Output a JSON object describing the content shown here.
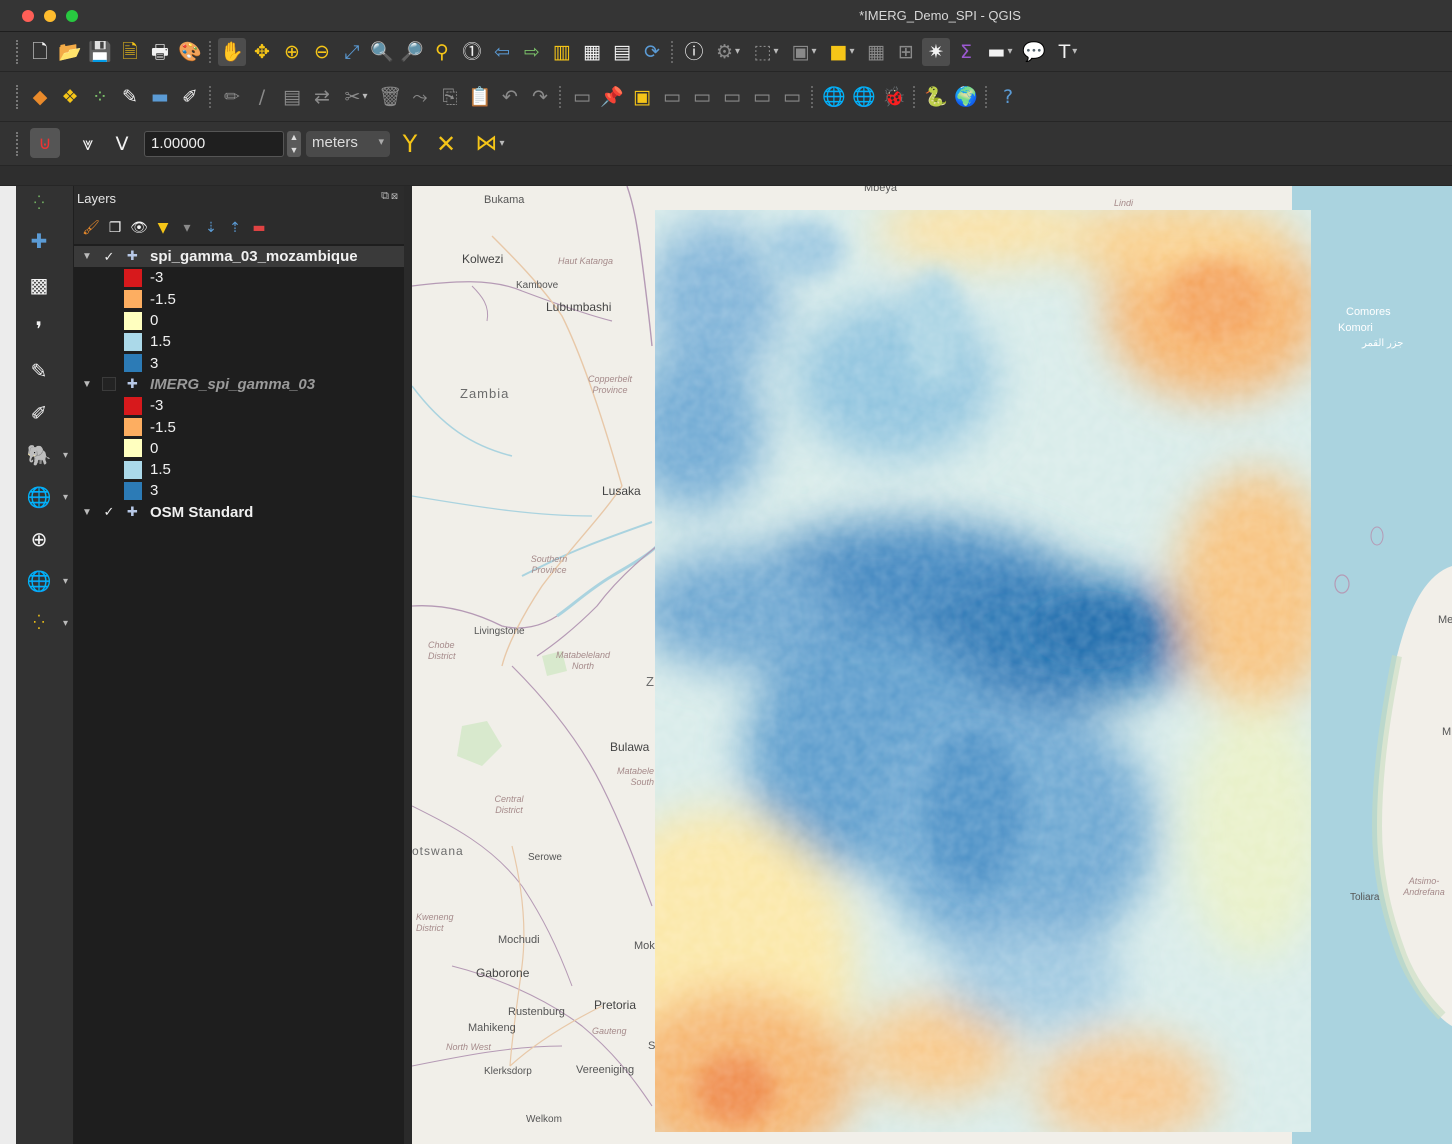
{
  "window": {
    "title": "*IMERG_Demo_SPI - QGIS"
  },
  "toolbar_row1": {
    "icons": [
      "new-project-icon",
      "open-project-icon",
      "save-project-icon",
      "save-as-icon",
      "print-layout-icon",
      "style-manager-icon",
      "pan-icon",
      "pan-to-selection-icon",
      "zoom-in-icon",
      "zoom-out-icon",
      "zoom-full-icon",
      "zoom-layer-icon",
      "zoom-selection-icon",
      "zoom-native-icon",
      "zoom-last-icon",
      "zoom-next-icon",
      "new-bookmark-icon",
      "show-bookmarks-icon",
      "temporal-controller-icon",
      "refresh-icon",
      "identify-icon",
      "actions-icon",
      "select-icon",
      "deselect-icon",
      "attribute-table-icon",
      "field-calculator-icon",
      "statistics-icon",
      "measure-icon",
      "map-tips-icon",
      "text-annotation-icon"
    ]
  },
  "toolbar_row3": {
    "tolerance_value": "1.00000",
    "units_value": "meters"
  },
  "layers_panel": {
    "title": "Layers",
    "layers": [
      {
        "name": "spi_gamma_03_mozambique",
        "checked": true,
        "italic": false,
        "legend": [
          {
            "label": "-3",
            "color": "#d7191c"
          },
          {
            "label": "-1.5",
            "color": "#fdae61"
          },
          {
            "label": "0",
            "color": "#ffffbf"
          },
          {
            "label": "1.5",
            "color": "#abd9e9"
          },
          {
            "label": "3",
            "color": "#2c7bb6"
          }
        ]
      },
      {
        "name": "IMERG_spi_gamma_03",
        "checked": false,
        "italic": true,
        "legend": [
          {
            "label": "-3",
            "color": "#d7191c"
          },
          {
            "label": "-1.5",
            "color": "#fdae61"
          },
          {
            "label": "0",
            "color": "#ffffbf"
          },
          {
            "label": "1.5",
            "color": "#abd9e9"
          },
          {
            "label": "3",
            "color": "#2c7bb6"
          }
        ]
      },
      {
        "name": "OSM Standard",
        "checked": true,
        "italic": false,
        "legend": []
      }
    ]
  },
  "map": {
    "places": {
      "bukama": "Bukama",
      "mbeya": "Mbeya",
      "lindi": "Lindi",
      "kolwezi": "Kolwezi",
      "haut_katanga": "Haut Katanga",
      "kambove": "Kambove",
      "lubumbashi": "Lubumbashi",
      "zambia": "Zambia",
      "copperbelt": "Copperbelt Province",
      "lusaka": "Lusaka",
      "southern": "Southern Province",
      "livingstone": "Livingstone",
      "chobe": "Chobe District",
      "matabeleland_north": "Matabeleland North",
      "z": "Z",
      "bulawayo": "Bulawa",
      "matabeleland_south": "Matabele South",
      "central": "Central District",
      "botswana": "otswana",
      "serowe": "Serowe",
      "kweneng": "Kweneng District",
      "mochudi": "Mochudi",
      "mok": "Mok",
      "gaborone": "Gaborone",
      "rustenburg": "Rustenburg",
      "pretoria": "Pretoria",
      "mahikeng": "Mahikeng",
      "gauteng": "Gauteng",
      "north_west": "North West",
      "s": "S",
      "klerksdorp": "Klerksdorp",
      "vereeniging": "Vereeniging",
      "welkom": "Welkom",
      "comores": "Comores",
      "komori": "Komori",
      "comores_arabic": "جزر القمر",
      "me": "Me",
      "m": "M",
      "toliara": "Toliara",
      "atsimo": "Atsimo-Andrefana"
    },
    "colors": {
      "land": "#f1efe9",
      "water": "#aad3df",
      "boundary": "#b59ab5"
    }
  }
}
